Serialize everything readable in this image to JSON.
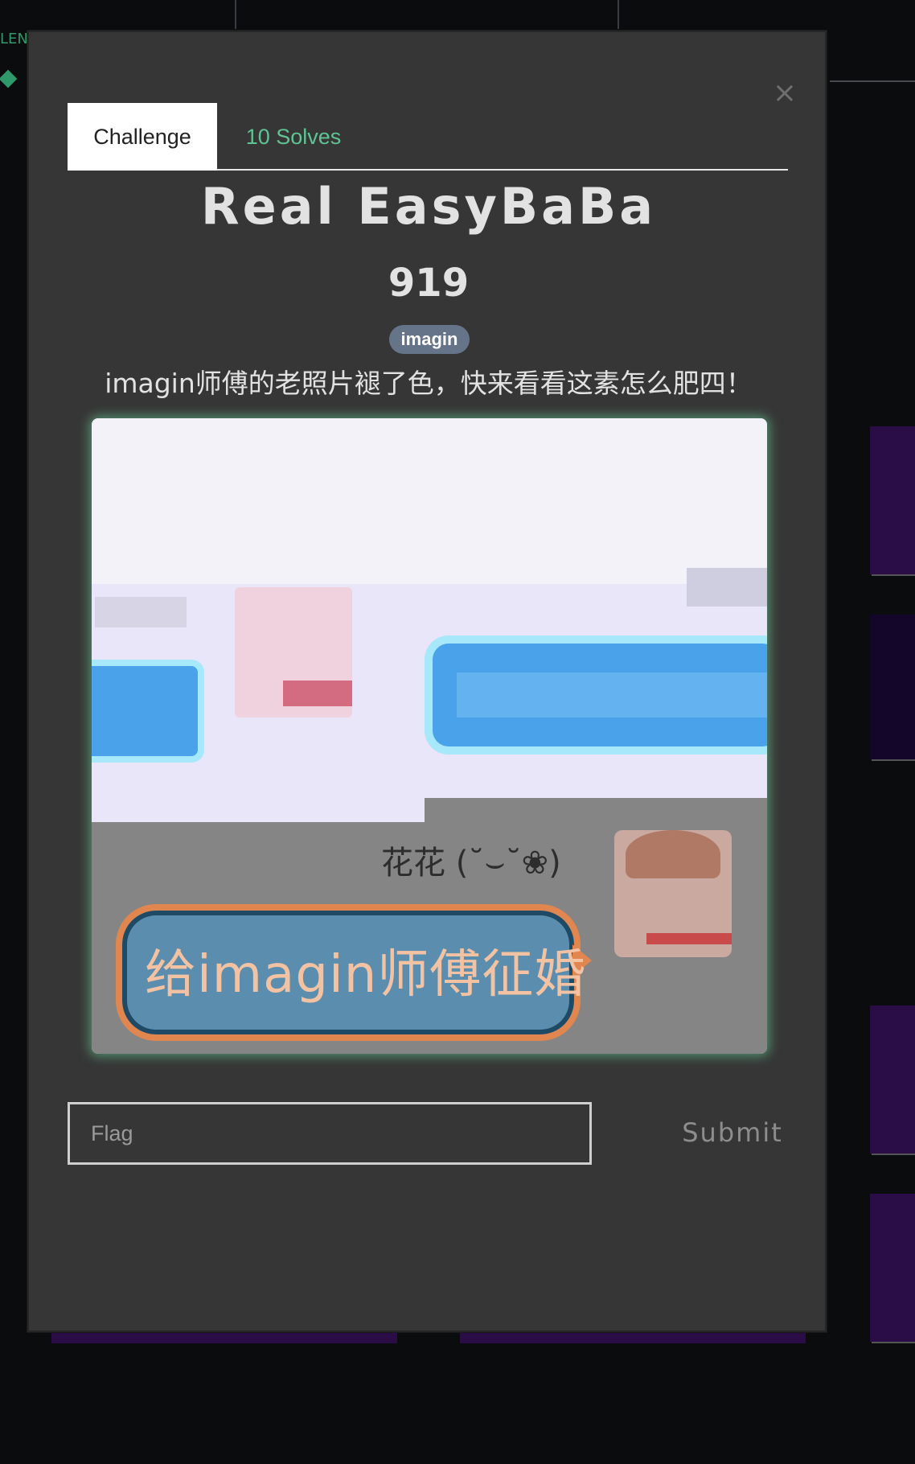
{
  "background": {
    "left_text": "LEN"
  },
  "modal": {
    "close_label": "×",
    "tabs": [
      {
        "label": "Challenge",
        "active": true
      },
      {
        "label": "10 Solves",
        "active": false
      }
    ],
    "title": "Real EasyBaBa",
    "points": "919",
    "tag": "imagin",
    "description": "imagin师傅的老照片褪了色，快来看看这素怎么肥四！",
    "image": {
      "name_label": "花花 (˘⌣˘❀)",
      "bubble_text": "给imagin师傅征婚"
    },
    "flag_placeholder": "Flag",
    "submit_label": "Submit"
  },
  "colors": {
    "accent_green": "#5ec493",
    "tag_bg": "#66748a",
    "modal_bg": "#363636",
    "page_bg": "#0b0c0e",
    "bg_card_purple": "#2a0d47"
  }
}
